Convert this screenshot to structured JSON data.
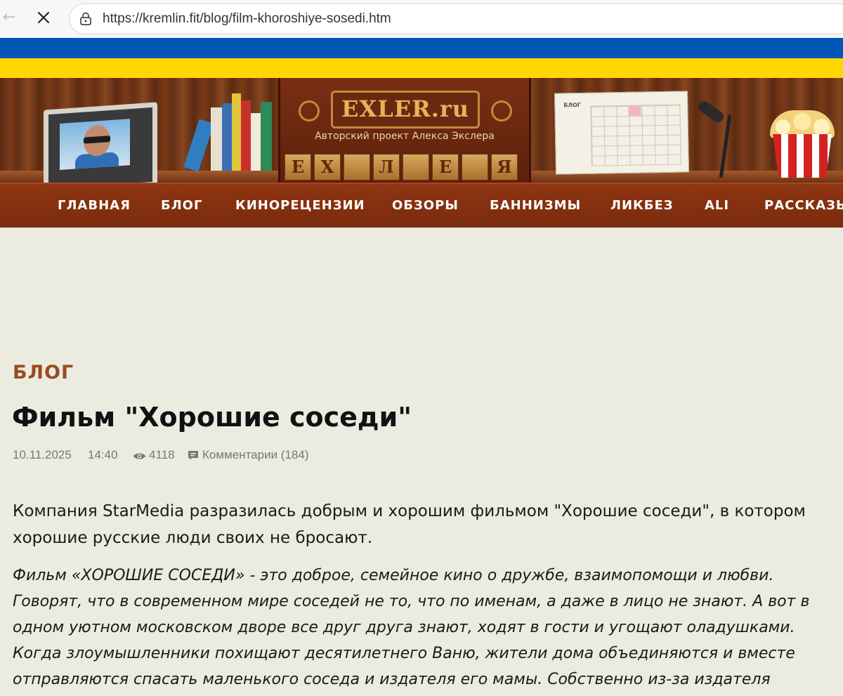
{
  "browser": {
    "url": "https://kremlin.fit/blog/film-khoroshiye-sosedi.htm",
    "back_icon": "arrow-left-icon",
    "stop_icon": "close-icon",
    "site_info_icon": "lock-icon"
  },
  "flag": {
    "top_color": "#0057b7",
    "bottom_color": "#ffd700"
  },
  "header": {
    "logo": "EXLER.ru",
    "tagline": "Авторский проект Алекса Экслера",
    "calendar_label": "БЛОГ",
    "letter_blocks": [
      "Е",
      "Х",
      "",
      "Л",
      "",
      "Е",
      "",
      "Я"
    ]
  },
  "nav": {
    "items": [
      {
        "label": "ГЛАВНАЯ"
      },
      {
        "label": "БЛОГ"
      },
      {
        "label": "КИНОРЕЦЕНЗИИ"
      },
      {
        "label": "ОБЗОРЫ"
      },
      {
        "label": "БАННИЗМЫ"
      },
      {
        "label": "ЛИКБЕЗ"
      },
      {
        "label": "ALI"
      },
      {
        "label": "РАССКАЗЫ"
      }
    ]
  },
  "article": {
    "section": "БЛОГ",
    "title": "Фильм \"Хорошие соседи\"",
    "date": "10.11.2025",
    "time": "14:40",
    "views": "4118",
    "comments": "Комментарии (184)",
    "lead": "Компания StarMedia разразилась добрым и хорошим фильмом \"Хорошие соседи\", в котором хорошие русские люди своих не бросают.",
    "quote": "Фильм «ХОРОШИЕ СОСЕДИ» - это доброе, семейное кино о дружбе, взаимопомощи и любви. Говорят, что в современном мире соседей не то, что по именам, а даже в лицо не знают. А вот в одном уютном московском дворе все друг друга знают, ходят в гости и угощают оладушками. Когда злоумышленники похищают десятилетнего Ваню, жители дома объединяются и вместе отправляются спасать маленького соседа и издателя его мамы. Собственно из-за издателя"
  }
}
